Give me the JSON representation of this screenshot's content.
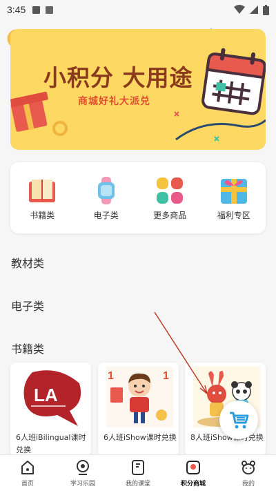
{
  "status_bar": {
    "time": "3:45"
  },
  "banner": {
    "title": "小积分 大用途",
    "subtitle": "商城好礼大派兑"
  },
  "categories": [
    {
      "label": "书籍类",
      "icon": "book-icon"
    },
    {
      "label": "电子类",
      "icon": "smartwatch-icon"
    },
    {
      "label": "更多商品",
      "icon": "more-grid-icon"
    },
    {
      "label": "福利专区",
      "icon": "gift-icon"
    }
  ],
  "sections": {
    "textbooks": "教材类",
    "electronics": "电子类",
    "books": "书籍类"
  },
  "products": [
    {
      "name": "6人班iBilingual课时兑换",
      "image": "LA logo"
    },
    {
      "name": "6人班iShow课时兑换",
      "image": "cartoon boy"
    },
    {
      "name": "8人班iShow课时兑换",
      "image": "cartoon rabbit and panda"
    }
  ],
  "bottom_nav": [
    {
      "label": "首页",
      "icon": "home-icon"
    },
    {
      "label": "学习乐园",
      "icon": "camera-icon"
    },
    {
      "label": "我的课堂",
      "icon": "classroom-icon"
    },
    {
      "label": "积分商城",
      "icon": "mall-icon",
      "active": true
    },
    {
      "label": "我的",
      "icon": "bear-profile-icon"
    }
  ],
  "colors": {
    "banner_bg": "#fdd862",
    "banner_title": "#8a3b1d",
    "banner_sub": "#e04d30",
    "cart_blue": "#2d9cdb"
  }
}
